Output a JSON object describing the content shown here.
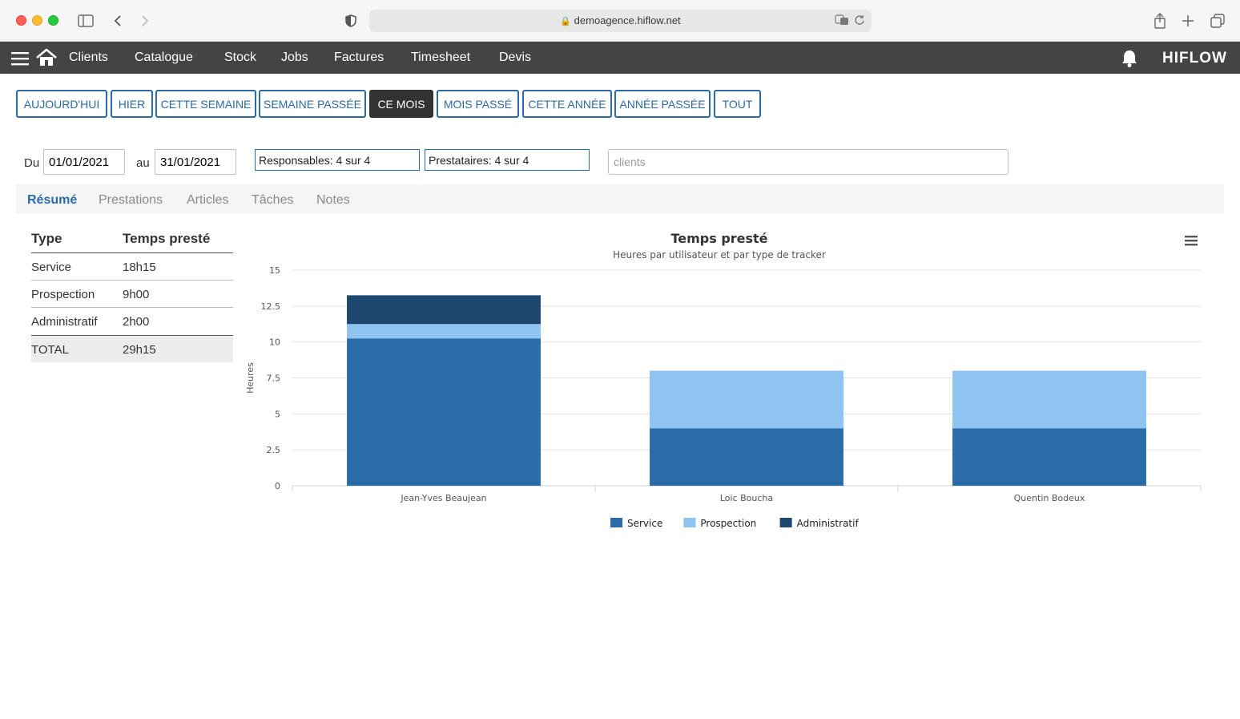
{
  "browser": {
    "url": "demoagence.hiflow.net"
  },
  "nav": {
    "items": [
      "Clients",
      "Catalogue",
      "Stock",
      "Jobs",
      "Factures",
      "Timesheet",
      "Devis"
    ],
    "logo": "HIFLOW"
  },
  "periods": {
    "buttons": [
      "AUJOURD'HUI",
      "HIER",
      "CETTE SEMAINE",
      "SEMAINE PASSÉE",
      "CE MOIS",
      "MOIS PASSÉ",
      "CETTE ANNÉE",
      "ANNÉE PASSÉE",
      "TOUT"
    ],
    "active": "CE MOIS"
  },
  "filters": {
    "from_label": "Du",
    "from_value": "01/01/2021",
    "to_label": "au",
    "to_value": "31/01/2021",
    "responsables": "Responsables: 4 sur 4",
    "prestataires": "Prestataires: 4 sur 4",
    "clients_placeholder": "clients"
  },
  "tabs": {
    "items": [
      "Résumé",
      "Prestations",
      "Articles",
      "Tâches",
      "Notes"
    ],
    "active": "Résumé"
  },
  "summary": {
    "header_type": "Type",
    "header_time": "Temps presté",
    "rows": [
      {
        "type": "Service",
        "time": "18h15"
      },
      {
        "type": "Prospection",
        "time": "9h00"
      },
      {
        "type": "Administratif",
        "time": "2h00"
      }
    ],
    "total_label": "TOTAL",
    "total_value": "29h15"
  },
  "chart_data": {
    "type": "bar",
    "stacked": true,
    "title": "Temps presté",
    "subtitle": "Heures par utilisateur et par type de tracker",
    "xlabel": "",
    "ylabel": "Heures",
    "ylim": [
      0,
      15
    ],
    "yticks": [
      "0",
      "2.5",
      "5",
      "7.5",
      "10",
      "12.5",
      "15"
    ],
    "categories": [
      "Jean-Yves Beaujean",
      "Loic Boucha",
      "Quentin Bodeux"
    ],
    "series": [
      {
        "name": "Service",
        "color": "#2b6ca8",
        "values": [
          10.25,
          4,
          4
        ]
      },
      {
        "name": "Prospection",
        "color": "#8fc3f0",
        "values": [
          1,
          4,
          4
        ]
      },
      {
        "name": "Administratif",
        "color": "#1f4870",
        "values": [
          2,
          0,
          0
        ]
      }
    ],
    "grid": true,
    "legend": "bottom"
  }
}
